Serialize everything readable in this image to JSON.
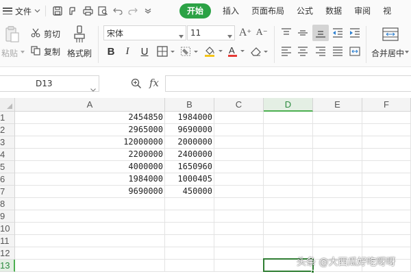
{
  "menu": {
    "file_label": "文件",
    "tabs": [
      {
        "label": "开始",
        "active": true
      },
      {
        "label": "插入",
        "active": false
      },
      {
        "label": "页面布局",
        "active": false
      },
      {
        "label": "公式",
        "active": false
      },
      {
        "label": "数据",
        "active": false
      },
      {
        "label": "审阅",
        "active": false
      },
      {
        "label": "视",
        "active": false
      }
    ]
  },
  "ribbon": {
    "paste_label": "粘贴",
    "cut_label": "剪切",
    "copy_label": "复制",
    "format_painter_label": "格式刷",
    "font_name": "宋体",
    "font_size": "11",
    "bold": "B",
    "italic": "I",
    "underline": "U",
    "font_color_letter": "A",
    "grow_font": "A",
    "shrink_font": "A",
    "merge_center_label": "合并居中"
  },
  "formula_bar": {
    "cell_ref": "D13",
    "fx_label": "fx",
    "formula": ""
  },
  "sheet": {
    "columns": [
      "A",
      "B",
      "C",
      "D",
      "E",
      "F"
    ],
    "selected_column": "D",
    "selected_row": "13",
    "rows": [
      {
        "num": "1",
        "A": "2454850",
        "B": "1984000"
      },
      {
        "num": "2",
        "A": "2965000",
        "B": "9690000"
      },
      {
        "num": "3",
        "A": "12000000",
        "B": "2000000"
      },
      {
        "num": "4",
        "A": "2200000",
        "B": "2400000"
      },
      {
        "num": "5",
        "A": "4000000",
        "B": "1650960"
      },
      {
        "num": "6",
        "A": "1984000",
        "B": "1000405"
      },
      {
        "num": "7",
        "A": "9690000",
        "B": "450000"
      },
      {
        "num": "8",
        "A": "",
        "B": ""
      },
      {
        "num": "9",
        "A": "",
        "B": ""
      },
      {
        "num": "10",
        "A": "",
        "B": ""
      },
      {
        "num": "11",
        "A": "",
        "B": ""
      },
      {
        "num": "12",
        "A": "",
        "B": ""
      },
      {
        "num": "13",
        "A": "",
        "B": ""
      }
    ]
  },
  "watermark": "头条 @大西瓜好吃呀呀",
  "colors": {
    "accent_green": "#2ba245",
    "selection_green": "#2e7d32",
    "font_color_red": "#e53935",
    "highlight_yellow": "#f5c518"
  },
  "icons": [
    "menu-icon",
    "save-icon",
    "format-icon",
    "print-icon",
    "print-preview-icon",
    "undo-icon",
    "redo-icon",
    "more-icon",
    "paste-icon",
    "cut-icon",
    "copy-icon",
    "format-painter-icon",
    "border-icon",
    "fill-color-icon",
    "font-color-icon",
    "eraser-icon",
    "align-top-icon",
    "align-middle-icon",
    "align-bottom-icon",
    "indent-decrease-icon",
    "indent-increase-icon",
    "align-left-icon",
    "align-center-icon",
    "align-right-icon",
    "justify-icon",
    "distributed-icon",
    "merge-center-icon",
    "zoom-icon"
  ]
}
